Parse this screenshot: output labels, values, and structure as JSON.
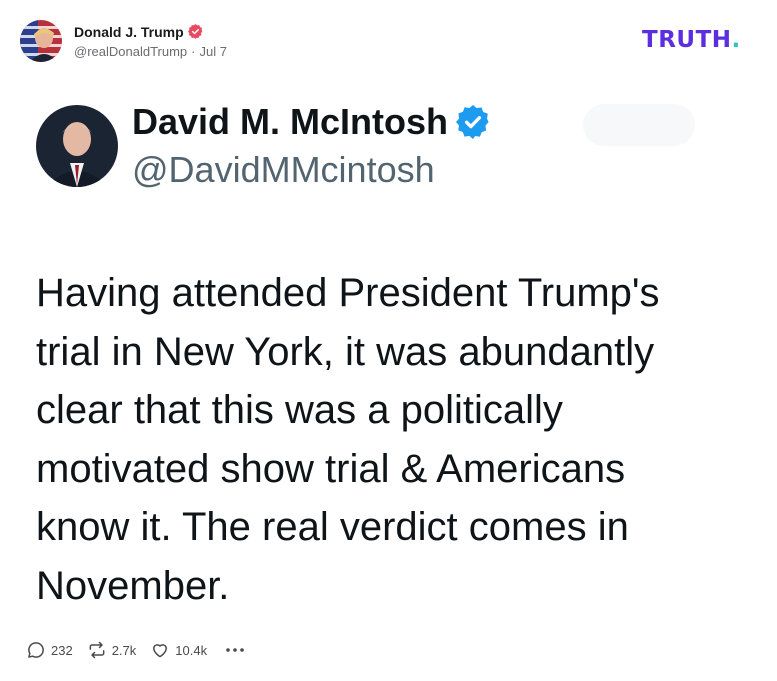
{
  "post": {
    "author_name": "Donald J. Trump",
    "handle": "@realDonaldTrump",
    "separator": "·",
    "date": "Jul 7"
  },
  "brand": {
    "logo_text": "TRUTH",
    "logo_dot": ".",
    "color": "#5b2ee0",
    "dot_color": "#2ec4c4"
  },
  "embed": {
    "author_name": "David M. McIntosh",
    "handle": "@DavidMMcintosh",
    "verified_color": "#1d9bf0",
    "text": "Having attended President Trump's\ntrial in New York, it was abundantly\nclear that this was a politically\nmotivated show trial & Americans\nknow it. The real verdict comes in\nNovember."
  },
  "actions": {
    "replies": "232",
    "reposts": "2.7k",
    "likes": "10.4k",
    "more_icon": "more-dots-icon"
  },
  "colors": {
    "verified_red": "#e84a5f"
  }
}
